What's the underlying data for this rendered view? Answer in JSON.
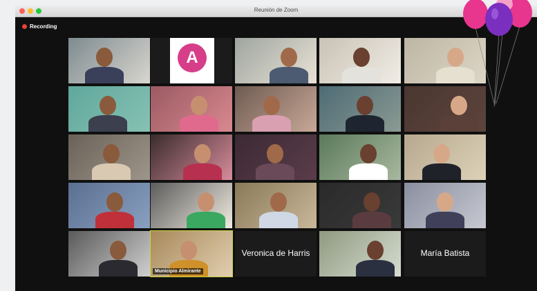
{
  "window": {
    "title": "Reunión de Zoom"
  },
  "recording": {
    "label": "Recording"
  },
  "tiles": [
    {
      "row": 0,
      "col": 0,
      "kind": "video"
    },
    {
      "row": 0,
      "col": 1,
      "kind": "logo",
      "logo_text": "A"
    },
    {
      "row": 0,
      "col": 2,
      "kind": "video"
    },
    {
      "row": 0,
      "col": 3,
      "kind": "video"
    },
    {
      "row": 0,
      "col": 4,
      "kind": "video"
    },
    {
      "row": 1,
      "col": 0,
      "kind": "video"
    },
    {
      "row": 1,
      "col": 1,
      "kind": "video"
    },
    {
      "row": 1,
      "col": 2,
      "kind": "video"
    },
    {
      "row": 1,
      "col": 3,
      "kind": "video"
    },
    {
      "row": 1,
      "col": 4,
      "kind": "video"
    },
    {
      "row": 2,
      "col": 0,
      "kind": "video"
    },
    {
      "row": 2,
      "col": 1,
      "kind": "video"
    },
    {
      "row": 2,
      "col": 2,
      "kind": "video"
    },
    {
      "row": 2,
      "col": 3,
      "kind": "video"
    },
    {
      "row": 2,
      "col": 4,
      "kind": "video"
    },
    {
      "row": 3,
      "col": 0,
      "kind": "video"
    },
    {
      "row": 3,
      "col": 1,
      "kind": "video"
    },
    {
      "row": 3,
      "col": 2,
      "kind": "video"
    },
    {
      "row": 3,
      "col": 3,
      "kind": "video"
    },
    {
      "row": 3,
      "col": 4,
      "kind": "video"
    },
    {
      "row": 4,
      "col": 0,
      "kind": "video"
    },
    {
      "row": 4,
      "col": 1,
      "kind": "video",
      "label": "Municipio Almirante",
      "active": true
    },
    {
      "row": 4,
      "col": 2,
      "kind": "name",
      "name": "Veronica de Harris"
    },
    {
      "row": 4,
      "col": 3,
      "kind": "video"
    },
    {
      "row": 4,
      "col": 4,
      "kind": "name",
      "name": "María Batista"
    }
  ],
  "decorations": {
    "balloon_colors": [
      "#e8358e",
      "#7b2fbf",
      "#e8358e"
    ]
  }
}
